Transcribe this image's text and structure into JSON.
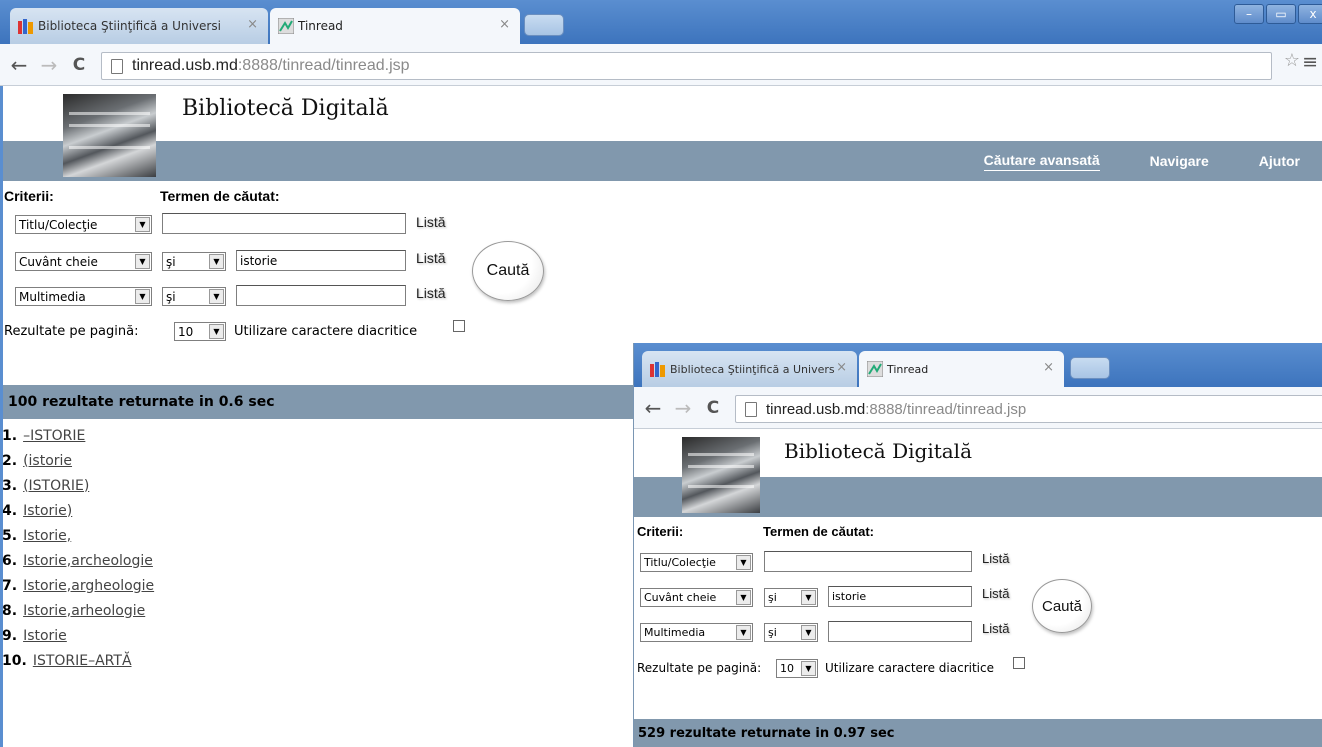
{
  "browser": {
    "tabs": [
      {
        "title": "Biblioteca Ştiinţifică a Universi",
        "active": false
      },
      {
        "title": "Tinread",
        "active": true
      }
    ],
    "tab_close": "×",
    "back": "←",
    "forward": "→",
    "reload": "C",
    "url_host": "tinread.usb.md",
    "url_rest": ":8888/tinread/tinread.jsp",
    "star": "☆",
    "menu": "≡",
    "win_min": "–",
    "win_max": "▭",
    "win_close": "x"
  },
  "site": {
    "title": "Bibliotecă Digitală",
    "nav": [
      "Căutare avansată",
      "Navigare",
      "Ajutor"
    ]
  },
  "search": {
    "criteria_label": "Criterii:",
    "term_label": "Termen de căutat:",
    "rows": [
      {
        "criterion": "Titlu/Colecţie",
        "operator": "",
        "value": "",
        "lista": "Listă"
      },
      {
        "criterion": "Cuvânt cheie",
        "operator": "şi",
        "value": "istorie",
        "lista": "Listă"
      },
      {
        "criterion": "Multimedia",
        "operator": "şi",
        "value": "",
        "lista": "Listă"
      }
    ],
    "submit": "Caută",
    "per_page_label": "Rezultate pe pagină:",
    "per_page_value": "10",
    "diacritics_label": "Utilizare caractere diacritice",
    "arrow": "▼"
  },
  "window1": {
    "summary": "100 rezultate returnate in 0.6 sec",
    "results": [
      {
        "num": "1.",
        "text": "–ISTORIE"
      },
      {
        "num": "2.",
        "text": "(istorie"
      },
      {
        "num": "3.",
        "text": "(ISTORIE)"
      },
      {
        "num": "4.",
        "text": "Istorie)"
      },
      {
        "num": "5.",
        "text": "Istorie,"
      },
      {
        "num": "6.",
        "text": "Istorie,archeologie"
      },
      {
        "num": "7.",
        "text": "Istorie,argheologie"
      },
      {
        "num": "8.",
        "text": "Istorie,arheologie"
      },
      {
        "num": "9.",
        "text": "Istorie"
      },
      {
        "num": "10.",
        "text": "ISTORIE–ARTĂ"
      }
    ]
  },
  "window2": {
    "summary": "529 rezultate returnate in 0.97 sec"
  },
  "colors": {
    "banner_bar": "#8198ad",
    "tabstrip": "#3d74bd"
  }
}
